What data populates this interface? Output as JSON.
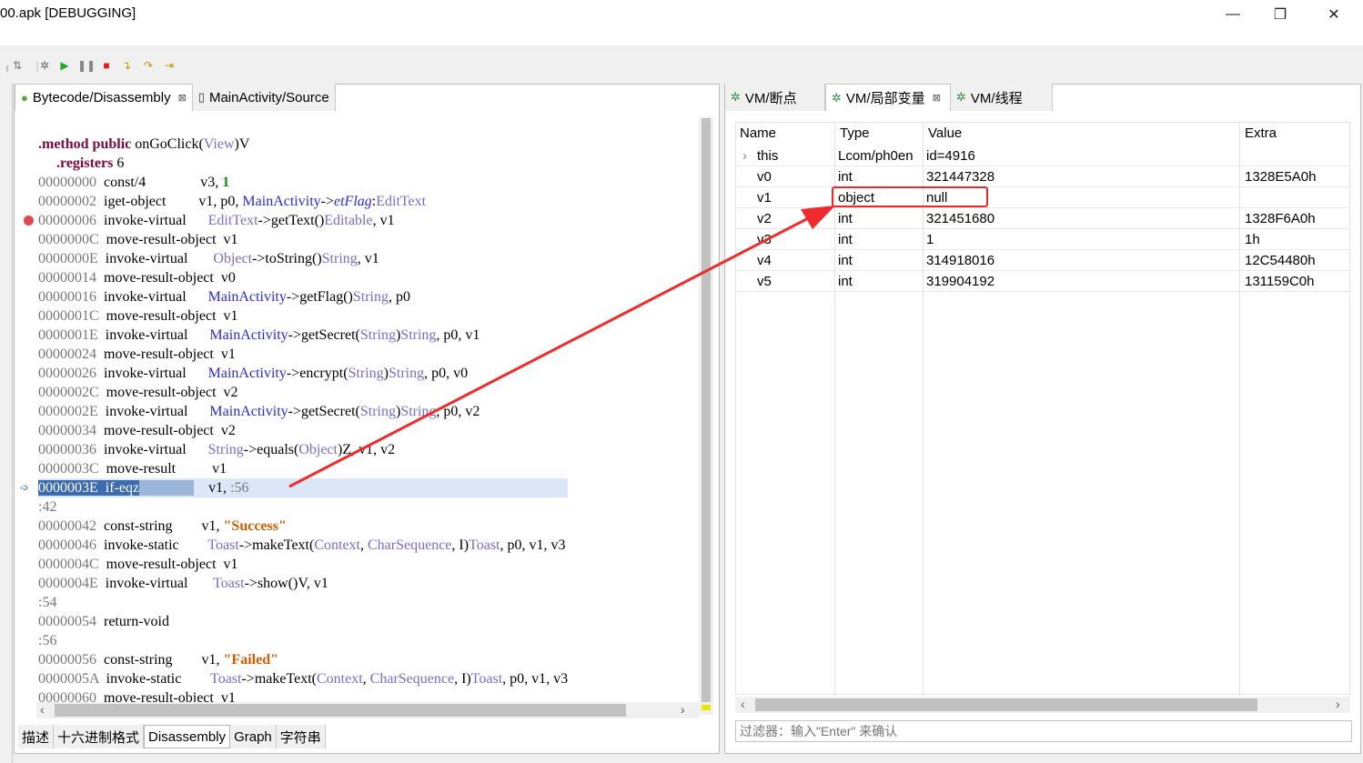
{
  "window": {
    "title": "00.apk [DEBUGGING]",
    "minimize": "—",
    "maximize": "❐",
    "close": "✕"
  },
  "toolbar": {
    "icons": [
      "bug-icon",
      "resume-icon",
      "pause-icon",
      "stop-icon",
      "step-into-icon",
      "step-over-icon",
      "step-out-icon"
    ]
  },
  "editor": {
    "tabs": [
      {
        "label": "Bytecode/Disassembly",
        "close": "⊠"
      },
      {
        "label": "MainActivity/Source"
      }
    ],
    "lines": [
      {
        "t": "method",
        "kw": ".method public",
        "name": " onGoClick(",
        "cls": "View",
        "tail": ")V"
      },
      {
        "t": "reg",
        "kw": ".registers",
        "tail": " 6"
      },
      {
        "addr": "00000000",
        "op": "  const/4",
        "args": [
          [
            "",
            "               v3, "
          ],
          [
            "num",
            "1"
          ]
        ]
      },
      {
        "addr": "00000002",
        "op": "  iget-object",
        "args": [
          [
            "",
            "         v1, p0, "
          ],
          [
            "b",
            "MainActivity"
          ],
          [
            "",
            "->"
          ],
          [
            "fld",
            "etFlag"
          ],
          [
            "",
            ":"
          ],
          [
            "c",
            "EditText"
          ]
        ]
      },
      {
        "addr": "00000006",
        "op": "  invoke-virtual",
        "args": [
          [
            "",
            "      "
          ],
          [
            "c",
            "EditText"
          ],
          [
            "",
            "->getText()"
          ],
          [
            "c",
            "Editable"
          ],
          [
            "",
            ", v1"
          ]
        ]
      },
      {
        "addr": "0000000C",
        "op": "  move-result-object",
        "args": [
          [
            "",
            "  v1"
          ]
        ]
      },
      {
        "addr": "0000000E",
        "op": "  invoke-virtual",
        "args": [
          [
            "",
            "       "
          ],
          [
            "c",
            "Object"
          ],
          [
            "",
            "->toString()"
          ],
          [
            "c",
            "String"
          ],
          [
            "",
            ", v1"
          ]
        ]
      },
      {
        "addr": "00000014",
        "op": "  move-result-object",
        "args": [
          [
            "",
            "  v0"
          ]
        ]
      },
      {
        "addr": "00000016",
        "op": "  invoke-virtual",
        "args": [
          [
            "",
            "      "
          ],
          [
            "b",
            "MainActivity"
          ],
          [
            "",
            "->getFlag()"
          ],
          [
            "c",
            "String"
          ],
          [
            "",
            ", p0"
          ]
        ]
      },
      {
        "addr": "0000001C",
        "op": "  move-result-object",
        "args": [
          [
            "",
            "  v1"
          ]
        ]
      },
      {
        "addr": "0000001E",
        "op": "  invoke-virtual",
        "args": [
          [
            "",
            "      "
          ],
          [
            "b",
            "MainActivity"
          ],
          [
            "",
            "->getSecret("
          ],
          [
            "c",
            "String"
          ],
          [
            "",
            ")"
          ],
          [
            "c",
            "String"
          ],
          [
            "",
            ", p0, v1"
          ]
        ]
      },
      {
        "addr": "00000024",
        "op": "  move-result-object",
        "args": [
          [
            "",
            "  v1"
          ]
        ]
      },
      {
        "addr": "00000026",
        "op": "  invoke-virtual",
        "args": [
          [
            "",
            "      "
          ],
          [
            "b",
            "MainActivity"
          ],
          [
            "",
            "->encrypt("
          ],
          [
            "c",
            "String"
          ],
          [
            "",
            ")"
          ],
          [
            "c",
            "String"
          ],
          [
            "",
            ", p0, v0"
          ]
        ]
      },
      {
        "addr": "0000002C",
        "op": "  move-result-object",
        "args": [
          [
            "",
            "  v2"
          ]
        ]
      },
      {
        "addr": "0000002E",
        "op": "  invoke-virtual",
        "args": [
          [
            "",
            "      "
          ],
          [
            "b",
            "MainActivity"
          ],
          [
            "",
            "->getSecret("
          ],
          [
            "c",
            "String"
          ],
          [
            "",
            ")"
          ],
          [
            "c",
            "String"
          ],
          [
            "",
            ", p0, v2"
          ]
        ]
      },
      {
        "addr": "00000034",
        "op": "  move-result-object",
        "args": [
          [
            "",
            "  v2"
          ]
        ]
      },
      {
        "addr": "00000036",
        "op": "  invoke-virtual",
        "args": [
          [
            "",
            "      "
          ],
          [
            "c",
            "String"
          ],
          [
            "",
            "->equals("
          ],
          [
            "c",
            "Object"
          ],
          [
            "",
            ")Z, v1, v2"
          ]
        ]
      },
      {
        "addr": "0000003C",
        "op": "  move-result",
        "args": [
          [
            "",
            "          v1"
          ]
        ]
      },
      {
        "t": "sel",
        "addr": "0000003E",
        "op": "  if-eqz",
        "pad": "               ",
        "tail1": "v1, ",
        "tail2": ":56"
      },
      {
        "t": "label",
        "text": ":42"
      },
      {
        "addr": "00000042",
        "op": "  const-string",
        "args": [
          [
            "",
            "        v1, "
          ],
          [
            "str",
            "\"Success\""
          ]
        ]
      },
      {
        "addr": "00000046",
        "op": "  invoke-static",
        "args": [
          [
            "",
            "        "
          ],
          [
            "c",
            "Toast"
          ],
          [
            "",
            "->makeText("
          ],
          [
            "c",
            "Context"
          ],
          [
            "",
            ", "
          ],
          [
            "c",
            "CharSequence"
          ],
          [
            "",
            ", I)"
          ],
          [
            "c",
            "Toast"
          ],
          [
            "",
            ", p0, v1, v3"
          ]
        ]
      },
      {
        "addr": "0000004C",
        "op": "  move-result-object",
        "args": [
          [
            "",
            "  v1"
          ]
        ]
      },
      {
        "addr": "0000004E",
        "op": "  invoke-virtual",
        "args": [
          [
            "",
            "       "
          ],
          [
            "c",
            "Toast"
          ],
          [
            "",
            "->show()V, v1"
          ]
        ]
      },
      {
        "t": "label",
        "text": ":54"
      },
      {
        "addr": "00000054",
        "op": "  return-void",
        "args": []
      },
      {
        "t": "label",
        "text": ":56"
      },
      {
        "addr": "00000056",
        "op": "  const-string",
        "args": [
          [
            "",
            "        v1, "
          ],
          [
            "str",
            "\"Failed\""
          ]
        ]
      },
      {
        "addr": "0000005A",
        "op": "  invoke-static",
        "args": [
          [
            "",
            "        "
          ],
          [
            "c",
            "Toast"
          ],
          [
            "",
            "->makeText("
          ],
          [
            "c",
            "Context"
          ],
          [
            "",
            ", "
          ],
          [
            "c",
            "CharSequence"
          ],
          [
            "",
            ", I)"
          ],
          [
            "c",
            "Toast"
          ],
          [
            "",
            ", p0, v1, v3"
          ]
        ]
      },
      {
        "addr": "00000060",
        "op": "  move-result-object",
        "args": [
          [
            "",
            "  v1"
          ]
        ]
      }
    ],
    "bottom_tabs": [
      "描述",
      "十六进制格式",
      "Disassembly",
      "Graph",
      "字符串"
    ]
  },
  "vm": {
    "tabs": [
      {
        "label": "VM/断点"
      },
      {
        "label": "VM/局部变量",
        "close": "⊠"
      },
      {
        "label": "VM/线程"
      }
    ],
    "columns": [
      "Name",
      "Type",
      "Value",
      "Extra"
    ],
    "rows": [
      {
        "name": "this",
        "expand": "›",
        "type": "Lcom/ph0en",
        "value": "id=4916",
        "extra": ""
      },
      {
        "name": "v0",
        "type": "int",
        "value": "321447328",
        "extra": "1328E5A0h"
      },
      {
        "name": "v1",
        "type": "object",
        "value": "null",
        "extra": ""
      },
      {
        "name": "v2",
        "type": "int",
        "value": "321451680",
        "extra": "1328F6A0h"
      },
      {
        "name": "v3",
        "type": "int",
        "value": "1",
        "extra": "1h"
      },
      {
        "name": "v4",
        "type": "int",
        "value": "314918016",
        "extra": "12C54480h"
      },
      {
        "name": "v5",
        "type": "int",
        "value": "319904192",
        "extra": "131159C0h"
      }
    ],
    "filter_placeholder": "过滤器：输入\"Enter\" 来确认"
  },
  "colors": {
    "highlight_box": "#ea2a2a",
    "arrow": "#ef2b2b",
    "selection": "#3d6bb0"
  }
}
